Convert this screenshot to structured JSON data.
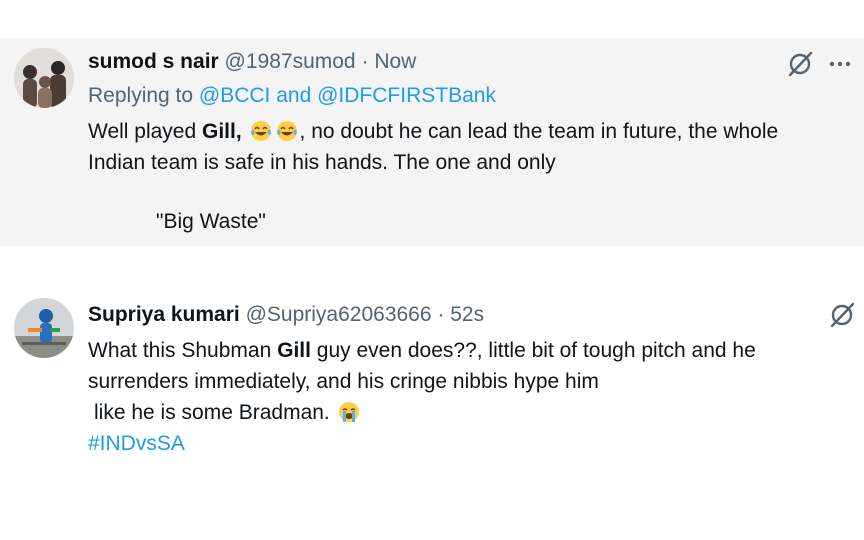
{
  "tweets": [
    {
      "name": "sumod s nair",
      "handle": "@1987sumod",
      "separator": "·",
      "time": "Now",
      "replying_prefix": "Replying to",
      "replying_to": "@BCCI and @IDFCFIRSTBank",
      "body": {
        "part1": "Well played",
        "bold": "Gill,",
        "emoji": "face-with-tears-of-joy",
        "part2": ", no doubt he can lead the team in future, the whole",
        "line2": "Indian team is safe in his hands. The one and only",
        "quote": "\"Big Waste\""
      },
      "icons": [
        "grok-icon",
        "more-icon"
      ]
    },
    {
      "name": "Supriya kumari",
      "handle": "@Supriya62063666",
      "separator": "·",
      "time": "52s",
      "body": {
        "part1": "What this Shubman",
        "bold": "Gill",
        "part2": "guy even does??, little bit of tough pitch and he",
        "line2": "surrenders immediately, and his cringe nibbis hype him",
        "line3": "like he is some Bradman.",
        "emoji": "loudly-crying-face",
        "hashtag": "#INDvsSA"
      },
      "icons": [
        "grok-icon"
      ]
    }
  ],
  "colors": {
    "link": "#1d9bf0",
    "secondary_text": "#536471",
    "primary_text": "#0f1419",
    "highlight_bg": "#f4f4f4"
  }
}
